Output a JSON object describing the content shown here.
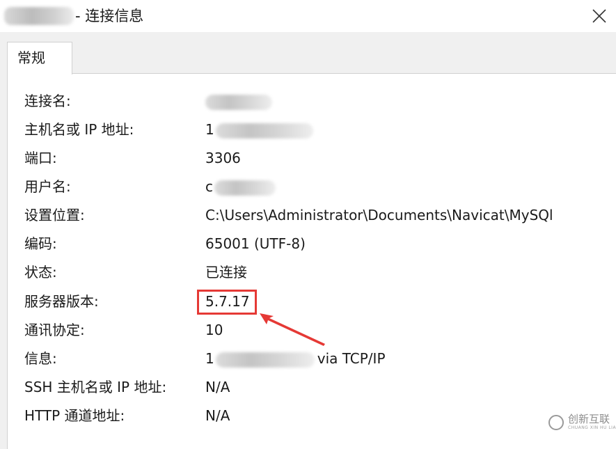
{
  "window": {
    "title": "- 连接信息",
    "close_glyph": "✕"
  },
  "tabs": [
    {
      "label": "常规",
      "selected": true
    }
  ],
  "rows": [
    {
      "label": "连接名:",
      "value": "",
      "redacted": true
    },
    {
      "label": "主机名或 IP 地址:",
      "value": "1",
      "redacted": true
    },
    {
      "label": "端口:",
      "value": "3306"
    },
    {
      "label": "用户名:",
      "value": "c",
      "redacted": true
    },
    {
      "label": "设置位置:",
      "value": "C:\\Users\\Administrator\\Documents\\Navicat\\MySQl"
    },
    {
      "label": "编码:",
      "value": "65001 (UTF-8)"
    },
    {
      "label": "状态:",
      "value": "已连接"
    },
    {
      "label": "服务器版本:",
      "value": "5.7.17",
      "highlighted": true
    },
    {
      "label": "通讯协定:",
      "value": "10"
    },
    {
      "label": "信息:",
      "value": "1",
      "value_suffix": "via TCP/IP",
      "redacted": true
    },
    {
      "label": "SSH 主机名或 IP 地址:",
      "value": "N/A"
    },
    {
      "label": "HTTP 通道地址:",
      "value": "N/A"
    }
  ],
  "annotation": {
    "highlight_color": "#e53935"
  },
  "watermark": {
    "text": "创新互联",
    "subtext": "CHUANG XIN HU LIAN"
  }
}
